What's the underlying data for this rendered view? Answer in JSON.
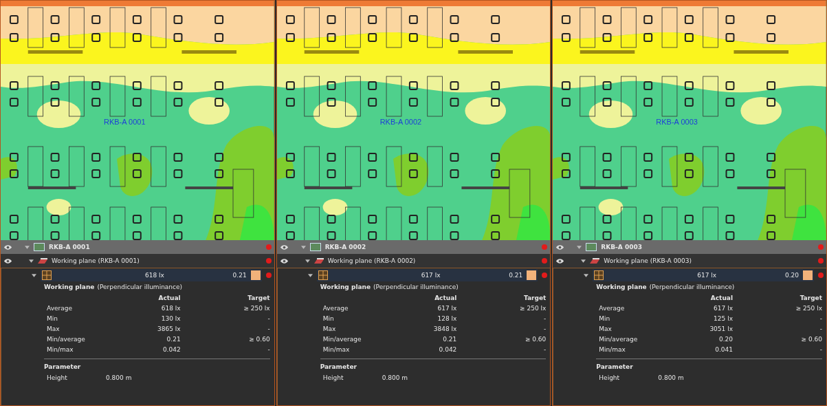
{
  "panels": [
    {
      "map_label": "RKB-A 0001",
      "room": "RKB-A 0001",
      "plane": "Working plane (RKB-A 0001)",
      "summary_value": "618 lx",
      "summary_ratio": "0.21",
      "section_title": "Working plane",
      "section_subtitle": "(Perpendicular illuminance)",
      "columns": [
        "Actual",
        "Target"
      ],
      "rows": [
        {
          "label": "Average",
          "actual": "618 lx",
          "target": "≥ 250 lx"
        },
        {
          "label": "Min",
          "actual": "130 lx",
          "target": "-"
        },
        {
          "label": "Max",
          "actual": "3865 lx",
          "target": "-"
        },
        {
          "label": "Min/average",
          "actual": "0.21",
          "target": "≥ 0.60"
        },
        {
          "label": "Min/max",
          "actual": "0.042",
          "target": "-"
        }
      ],
      "parameter_title": "Parameter",
      "parameters": [
        {
          "label": "Height",
          "value": "0.800 m"
        }
      ]
    },
    {
      "map_label": "RKB-A 0002",
      "room": "RKB-A 0002",
      "plane": "Working plane (RKB-A 0002)",
      "summary_value": "617 lx",
      "summary_ratio": "0.21",
      "section_title": "Working plane",
      "section_subtitle": "(Perpendicular illuminance)",
      "columns": [
        "Actual",
        "Target"
      ],
      "rows": [
        {
          "label": "Average",
          "actual": "617 lx",
          "target": "≥ 250 lx"
        },
        {
          "label": "Min",
          "actual": "128 lx",
          "target": "-"
        },
        {
          "label": "Max",
          "actual": "3848 lx",
          "target": "-"
        },
        {
          "label": "Min/average",
          "actual": "0.21",
          "target": "≥ 0.60"
        },
        {
          "label": "Min/max",
          "actual": "0.042",
          "target": "-"
        }
      ],
      "parameter_title": "Parameter",
      "parameters": [
        {
          "label": "Height",
          "value": "0.800 m"
        }
      ]
    },
    {
      "map_label": "RKB-A 0003",
      "room": "RKB-A 0003",
      "plane": "Working plane (RKB-A 0003)",
      "summary_value": "617 lx",
      "summary_ratio": "0.20",
      "section_title": "Working plane",
      "section_subtitle": "(Perpendicular illuminance)",
      "columns": [
        "Actual",
        "Target"
      ],
      "rows": [
        {
          "label": "Average",
          "actual": "617 lx",
          "target": "≥ 250 lx"
        },
        {
          "label": "Min",
          "actual": "125 lx",
          "target": "-"
        },
        {
          "label": "Max",
          "actual": "3051 lx",
          "target": "-"
        },
        {
          "label": "Min/average",
          "actual": "0.20",
          "target": "≥ 0.60"
        },
        {
          "label": "Min/max",
          "actual": "0.041",
          "target": "-"
        }
      ],
      "parameter_title": "Parameter",
      "parameters": [
        {
          "label": "Height",
          "value": "0.800 m"
        }
      ]
    }
  ]
}
